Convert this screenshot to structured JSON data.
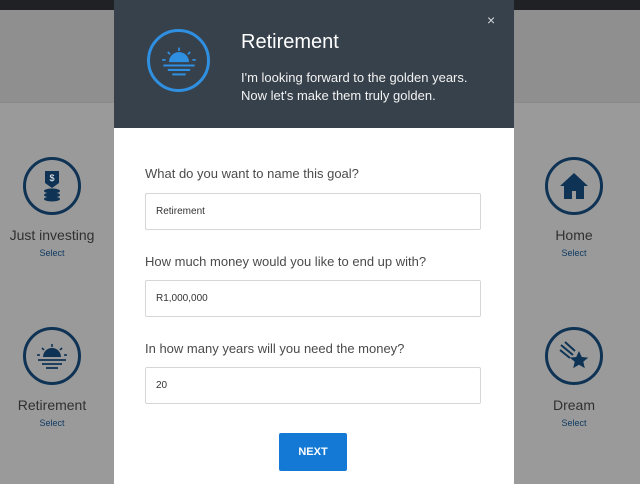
{
  "background_goals": [
    {
      "name": "Just investing",
      "select": "Select",
      "icon": "money-stack-icon"
    },
    {
      "name": "Retirement",
      "select": "Select",
      "icon": "sunset-icon"
    },
    {
      "name": "Home",
      "select": "Select",
      "icon": "house-icon"
    },
    {
      "name": "Dream",
      "select": "Select",
      "icon": "shooting-star-icon"
    }
  ],
  "modal": {
    "close": "×",
    "title": "Retirement",
    "subtitle_line1": "I'm looking forward to the golden years.",
    "subtitle_line2": "Now let's make them truly golden.",
    "icon": "sunset-icon",
    "questions": [
      {
        "label": "What do you want to name this goal?",
        "value": "Retirement"
      },
      {
        "label": "How much money would you like to end up with?",
        "value": "R1,000,000"
      },
      {
        "label": "In how many years will you need the money?",
        "value": "20"
      }
    ],
    "next_label": "NEXT"
  },
  "colors": {
    "modal_header": "#37414b",
    "accent_blue": "#1479d4",
    "icon_ring": "#2f8fe0",
    "navy": "#0f3354"
  }
}
